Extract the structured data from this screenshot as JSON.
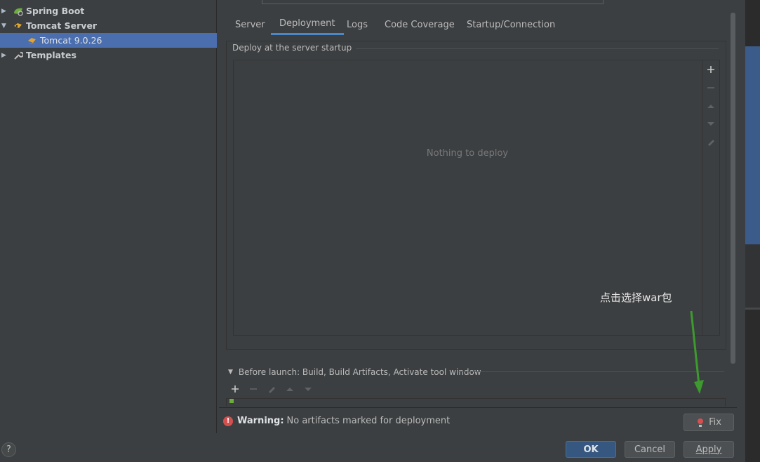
{
  "tree": {
    "items": [
      {
        "label": "Spring Boot",
        "icon": "spring-boot-icon"
      },
      {
        "label": "Tomcat Server",
        "icon": "tomcat-icon"
      },
      {
        "label": "Tomcat 9.0.26",
        "icon": "tomcat-config-icon"
      },
      {
        "label": "Templates",
        "icon": "wrench-icon"
      }
    ]
  },
  "help": {
    "label": "?"
  },
  "tabs": [
    {
      "label": "Server"
    },
    {
      "label": "Deployment"
    },
    {
      "label": "Logs"
    },
    {
      "label": "Code Coverage"
    },
    {
      "label": "Startup/Connection"
    }
  ],
  "deployment": {
    "group_title": "Deploy at the server startup",
    "empty_text": "Nothing to deploy",
    "toolbar_icons": [
      "add-icon",
      "remove-icon",
      "move-up-icon",
      "move-down-icon",
      "edit-icon"
    ]
  },
  "before_launch": {
    "label": "Before launch: Build, Build Artifacts, Activate tool window",
    "toolbar_icons": [
      "add-icon",
      "remove-icon",
      "edit-icon",
      "move-up-icon",
      "move-down-icon"
    ]
  },
  "warning": {
    "label": "Warning:",
    "text": "No artifacts marked for deployment"
  },
  "buttons": {
    "fix": "Fix",
    "ok": "OK",
    "cancel": "Cancel",
    "apply": "Apply"
  },
  "annotation": {
    "text": "点击选择war包",
    "arrow_color": "#3c9a2e"
  },
  "colors": {
    "selection": "#4b6eaf",
    "tab_underline": "#4a88c7",
    "primary_button": "#365880",
    "warning": "#d64f4f"
  }
}
